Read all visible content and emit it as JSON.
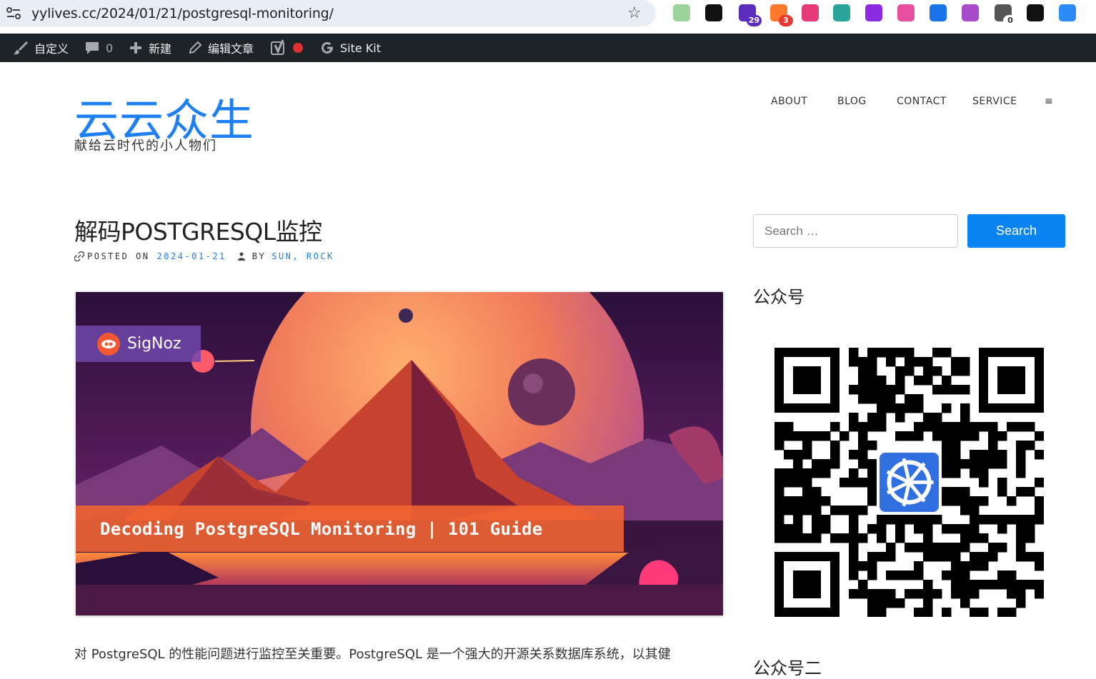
{
  "browser": {
    "url": "yylives.cc/2024/01/21/postgresql-monitoring/",
    "extensions": [
      {
        "name": "green-dot-extension-icon",
        "color": "#9bd39b",
        "badge": ""
      },
      {
        "name": "notion-extension-icon",
        "color": "#111111",
        "badge": ""
      },
      {
        "name": "graduation-cap-extension-icon",
        "color": "#5b2dbf",
        "badge": "29"
      },
      {
        "name": "cloud-extension-icon",
        "color": "#ff7a2e",
        "badge": "3"
      },
      {
        "name": "translate-extension-icon",
        "color": "#e5397a",
        "badge": ""
      },
      {
        "name": "dictionary-extension-icon",
        "color": "#2aa39a",
        "badge": ""
      },
      {
        "name": "lr-extension-icon",
        "color": "#8b2be2",
        "badge": ""
      },
      {
        "name": "cat-extension-icon",
        "color": "#e94fa0",
        "badge": ""
      },
      {
        "name": "pilcrow-extension-icon",
        "color": "#1a73e8",
        "badge": ""
      },
      {
        "name": "openai-extension-icon",
        "color": "#a64ac9",
        "badge": ""
      },
      {
        "name": "cursor-extension-icon",
        "color": "#555555",
        "badge": "0"
      },
      {
        "name": "hbase-extension-icon",
        "color": "#111111",
        "badge": ""
      },
      {
        "name": "blue-circle-extension-icon",
        "color": "#2b8cf7",
        "badge": ""
      }
    ]
  },
  "admin_bar": {
    "customize": "自定义",
    "comments_count": "0",
    "new": "新建",
    "edit_post": "编辑文章",
    "site_kit": "Site Kit"
  },
  "site": {
    "title": "云云众生",
    "description": "献给云时代的小人物们"
  },
  "nav": {
    "items": [
      "ABOUT",
      "BLOG",
      "CONTACT",
      "SERVICE"
    ],
    "menu_glyph": "≡"
  },
  "post": {
    "title": "解码POSTGRESQL监控",
    "posted_on_label": "POSTED ON",
    "date": "2024-01-21",
    "by_label": "BY",
    "author": "SUN, ROCK",
    "image_brand": "SigNoz",
    "image_caption": "Decoding PostgreSQL Monitoring | 101 Guide",
    "excerpt": "对 PostgreSQL 的性能问题进行监控至关重要。PostgreSQL 是一个强大的开源关系数据库系统，以其健"
  },
  "sidebar": {
    "search_placeholder": "Search …",
    "search_button": "Search",
    "widget_title": "公众号",
    "widget_title_2": "公众号二"
  },
  "colors": {
    "accent": "#1e7ff0",
    "search_button": "#0b84f3",
    "admin_bar": "#1d2327"
  }
}
